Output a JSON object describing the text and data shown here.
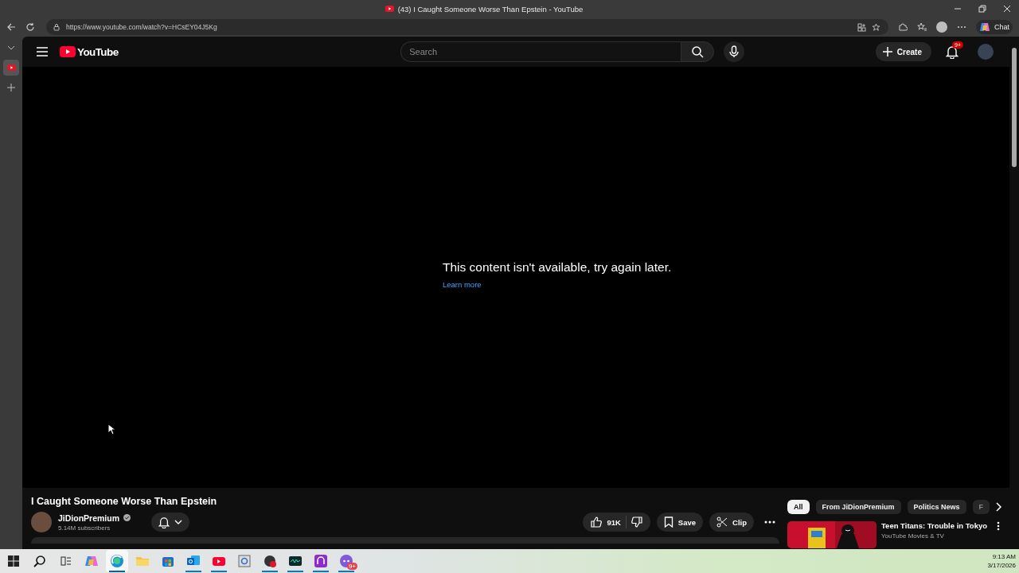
{
  "window": {
    "title": "(43) I Caught Someone Worse Than Epstein - YouTube"
  },
  "address_bar": {
    "url": "https://www.youtube.com/watch?v=HCsEY04J5Kg",
    "chat_label": "Chat"
  },
  "youtube": {
    "logo_text": "YouTube",
    "search": {
      "placeholder": "Search"
    },
    "create_label": "Create",
    "notification_badge": "9+"
  },
  "player": {
    "message": "This content isn't available, try again later.",
    "link": "Learn more"
  },
  "video": {
    "title": "I Caught Someone Worse Than Epstein",
    "channel": "JiDionPremium",
    "verified": true,
    "subscribers": "5.14M subscribers",
    "likes": "91K",
    "save_label": "Save",
    "clip_label": "Clip"
  },
  "chips": [
    {
      "label": "All",
      "selected": true
    },
    {
      "label": "From JiDionPremium",
      "selected": false
    },
    {
      "label": "Politics News",
      "selected": false
    },
    {
      "label": "F",
      "selected": false
    }
  ],
  "recommendations": [
    {
      "title": "Teen Titans: Trouble in Tokyo",
      "channel": "YouTube Movies & TV"
    }
  ],
  "taskbar": {
    "apps": [
      {
        "kind": "copilot",
        "selected": false,
        "running": false
      },
      {
        "kind": "edge",
        "selected": true,
        "running": true
      },
      {
        "kind": "folder",
        "selected": false,
        "running": false
      },
      {
        "kind": "store",
        "selected": false,
        "running": false
      },
      {
        "kind": "mail",
        "selected": false,
        "running": true
      },
      {
        "kind": "youtube",
        "selected": false,
        "running": true
      },
      {
        "kind": "frame",
        "selected": false,
        "running": false
      },
      {
        "kind": "recorder",
        "selected": false,
        "running": true
      },
      {
        "kind": "terminal",
        "selected": false,
        "running": true
      },
      {
        "kind": "headset",
        "selected": false,
        "running": true
      },
      {
        "kind": "chat",
        "selected": false,
        "running": true,
        "badge": "9+"
      }
    ],
    "time": "9:13 AM",
    "date": "3/17/2026"
  }
}
